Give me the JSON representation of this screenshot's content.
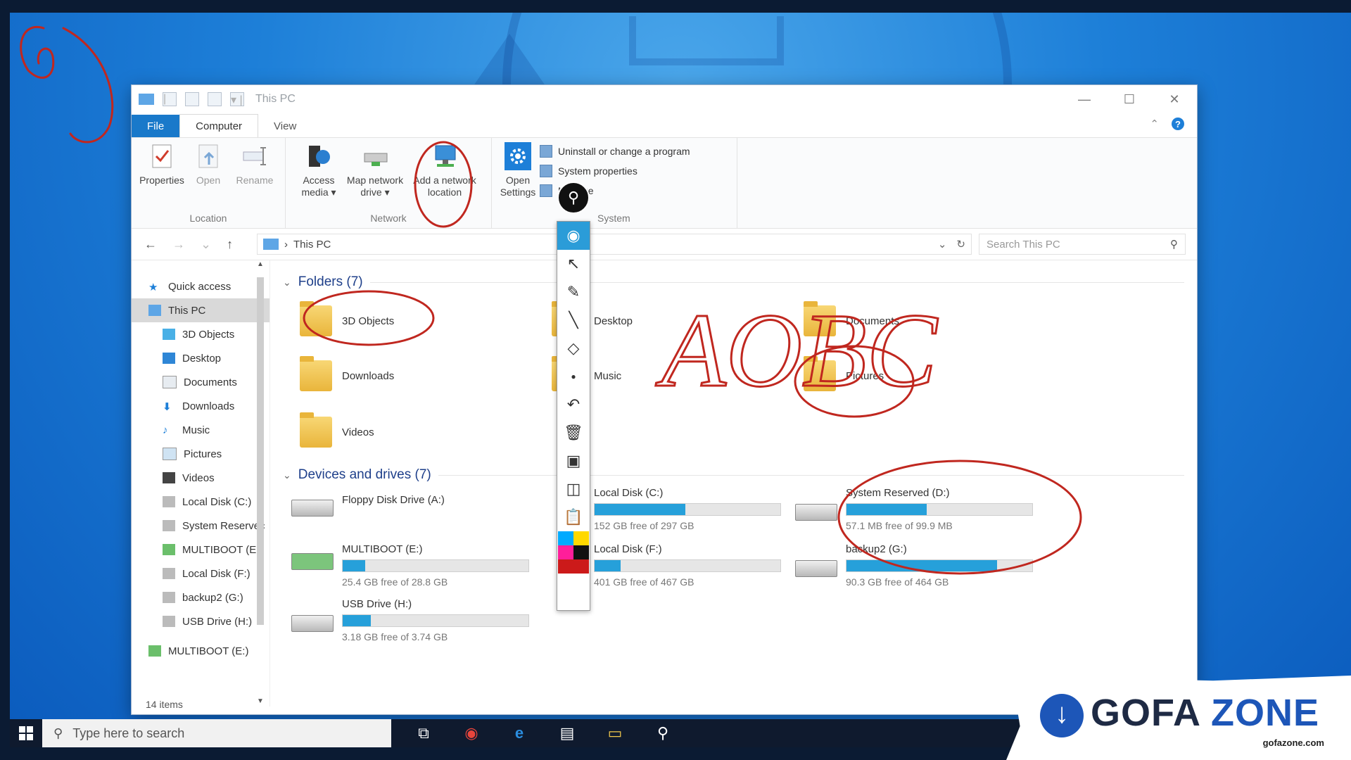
{
  "window": {
    "title": "This PC",
    "controls": {
      "minimize": "—",
      "maximize": "☐",
      "close": "✕"
    }
  },
  "tabs": [
    {
      "label": "File"
    },
    {
      "label": "Computer"
    },
    {
      "label": "View"
    }
  ],
  "ribbon": {
    "location": {
      "label": "Location",
      "buttons": [
        {
          "label": "Properties"
        },
        {
          "label": "Open"
        },
        {
          "label": "Rename"
        }
      ]
    },
    "network": {
      "label": "Network",
      "buttons": [
        {
          "label": "Access\nmedia ▾"
        },
        {
          "label": "Map network\ndrive ▾"
        },
        {
          "label": "Add a network\nlocation"
        }
      ]
    },
    "system": {
      "label": "System",
      "open_settings": "Open\nSettings",
      "items": [
        {
          "label": "Uninstall or change a program"
        },
        {
          "label": "System properties"
        },
        {
          "label": "Manage"
        }
      ]
    }
  },
  "address": {
    "path": "This PC",
    "search_placeholder": "Search This PC"
  },
  "navpane": {
    "items": [
      {
        "label": "Quick access",
        "level": 0
      },
      {
        "label": "This PC",
        "level": 0,
        "selected": true
      },
      {
        "label": "3D Objects",
        "level": 1
      },
      {
        "label": "Desktop",
        "level": 1
      },
      {
        "label": "Documents",
        "level": 1
      },
      {
        "label": "Downloads",
        "level": 1
      },
      {
        "label": "Music",
        "level": 1
      },
      {
        "label": "Pictures",
        "level": 1
      },
      {
        "label": "Videos",
        "level": 1
      },
      {
        "label": "Local Disk (C:)",
        "level": 1
      },
      {
        "label": "System Reservec",
        "level": 1
      },
      {
        "label": "MULTIBOOT (E:)",
        "level": 1
      },
      {
        "label": "Local Disk (F:)",
        "level": 1
      },
      {
        "label": "backup2 (G:)",
        "level": 1
      },
      {
        "label": "USB Drive (H:)",
        "level": 1
      },
      {
        "label": "MULTIBOOT (E:)",
        "level": 0
      }
    ]
  },
  "folders": {
    "header": "Folders (7)",
    "items": [
      {
        "label": "3D Objects"
      },
      {
        "label": "Desktop"
      },
      {
        "label": "Documents"
      },
      {
        "label": "Downloads"
      },
      {
        "label": "Music"
      },
      {
        "label": "Pictures"
      },
      {
        "label": "Videos"
      }
    ]
  },
  "drives": {
    "header": "Devices and drives (7)",
    "items": [
      {
        "label": "Floppy Disk Drive (A:)",
        "free": "",
        "used_fraction": null
      },
      {
        "label": "Local Disk (C:)",
        "free": "152 GB free of 297 GB",
        "used_fraction": 0.49
      },
      {
        "label": "System Reserved (D:)",
        "free": "57.1 MB free of 99.9 MB",
        "used_fraction": 0.43
      },
      {
        "label": "MULTIBOOT (E:)",
        "free": "25.4 GB free of 28.8 GB",
        "used_fraction": 0.12
      },
      {
        "label": "Local Disk (F:)",
        "free": "401 GB free of 467 GB",
        "used_fraction": 0.14
      },
      {
        "label": "backup2 (G:)",
        "free": "90.3 GB free of 464 GB",
        "used_fraction": 0.81
      },
      {
        "label": "USB Drive (H:)",
        "free": "3.18 GB free of 3.74 GB",
        "used_fraction": 0.15
      }
    ]
  },
  "status": {
    "items": "14 items"
  },
  "taskbar": {
    "search_placeholder": "Type here to search"
  },
  "drawing_toolbar": {
    "tools": [
      "eye-icon",
      "pointer-icon",
      "highlighter-icon",
      "line-icon",
      "eraser-icon",
      "dot-icon",
      "undo-icon",
      "trash-icon",
      "screen-icon",
      "camera-icon",
      "clipboard-icon"
    ],
    "palette": [
      "#00aaff",
      "#ffd800",
      "#ff1e9a",
      "#111111",
      "#cc1a1a",
      "#cc1a1a"
    ]
  },
  "logo": {
    "wordmark_a": "GOFA",
    "wordmark_b": "ZONE",
    "domain": "gofazone.com"
  },
  "annotations": {
    "handwriting": "AOBC"
  }
}
